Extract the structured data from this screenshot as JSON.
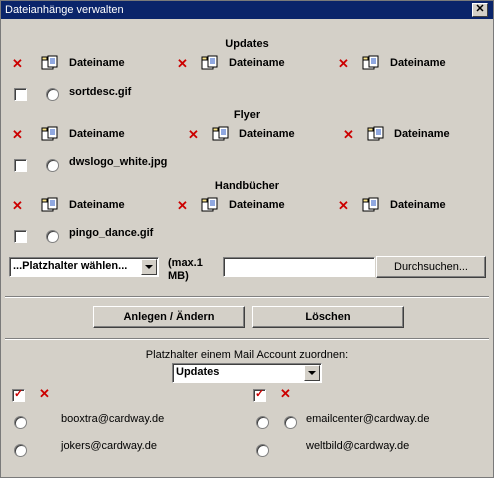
{
  "window": {
    "title": "Dateianhänge verwalten",
    "close_glyph": "✕"
  },
  "sections": [
    {
      "title": "Updates",
      "col_label": "Dateiname",
      "file": "sortdesc.gif"
    },
    {
      "title": "Flyer",
      "col_label": "Dateiname",
      "file": "dwslogo_white.jpg"
    },
    {
      "title": "Handbücher",
      "col_label": "Dateiname",
      "file": "pingo_dance.gif"
    }
  ],
  "upload": {
    "placeholder_select": "...Platzhalter wählen...",
    "max_label": "(max.1 MB)",
    "browse_label": "Durchsuchen..."
  },
  "actions": {
    "create_label": "Anlegen / Ändern",
    "delete_label": "Löschen"
  },
  "assign": {
    "label": "Platzhalter einem Mail Account zuordnen:",
    "selected": "Updates",
    "accounts": [
      "booxtra@cardway.de",
      "emailcenter@cardway.de",
      "jokers@cardway.de",
      "weltbild@cardway.de"
    ]
  },
  "icons": {
    "delete": "red-x-icon",
    "file": "folder-file-icon"
  }
}
